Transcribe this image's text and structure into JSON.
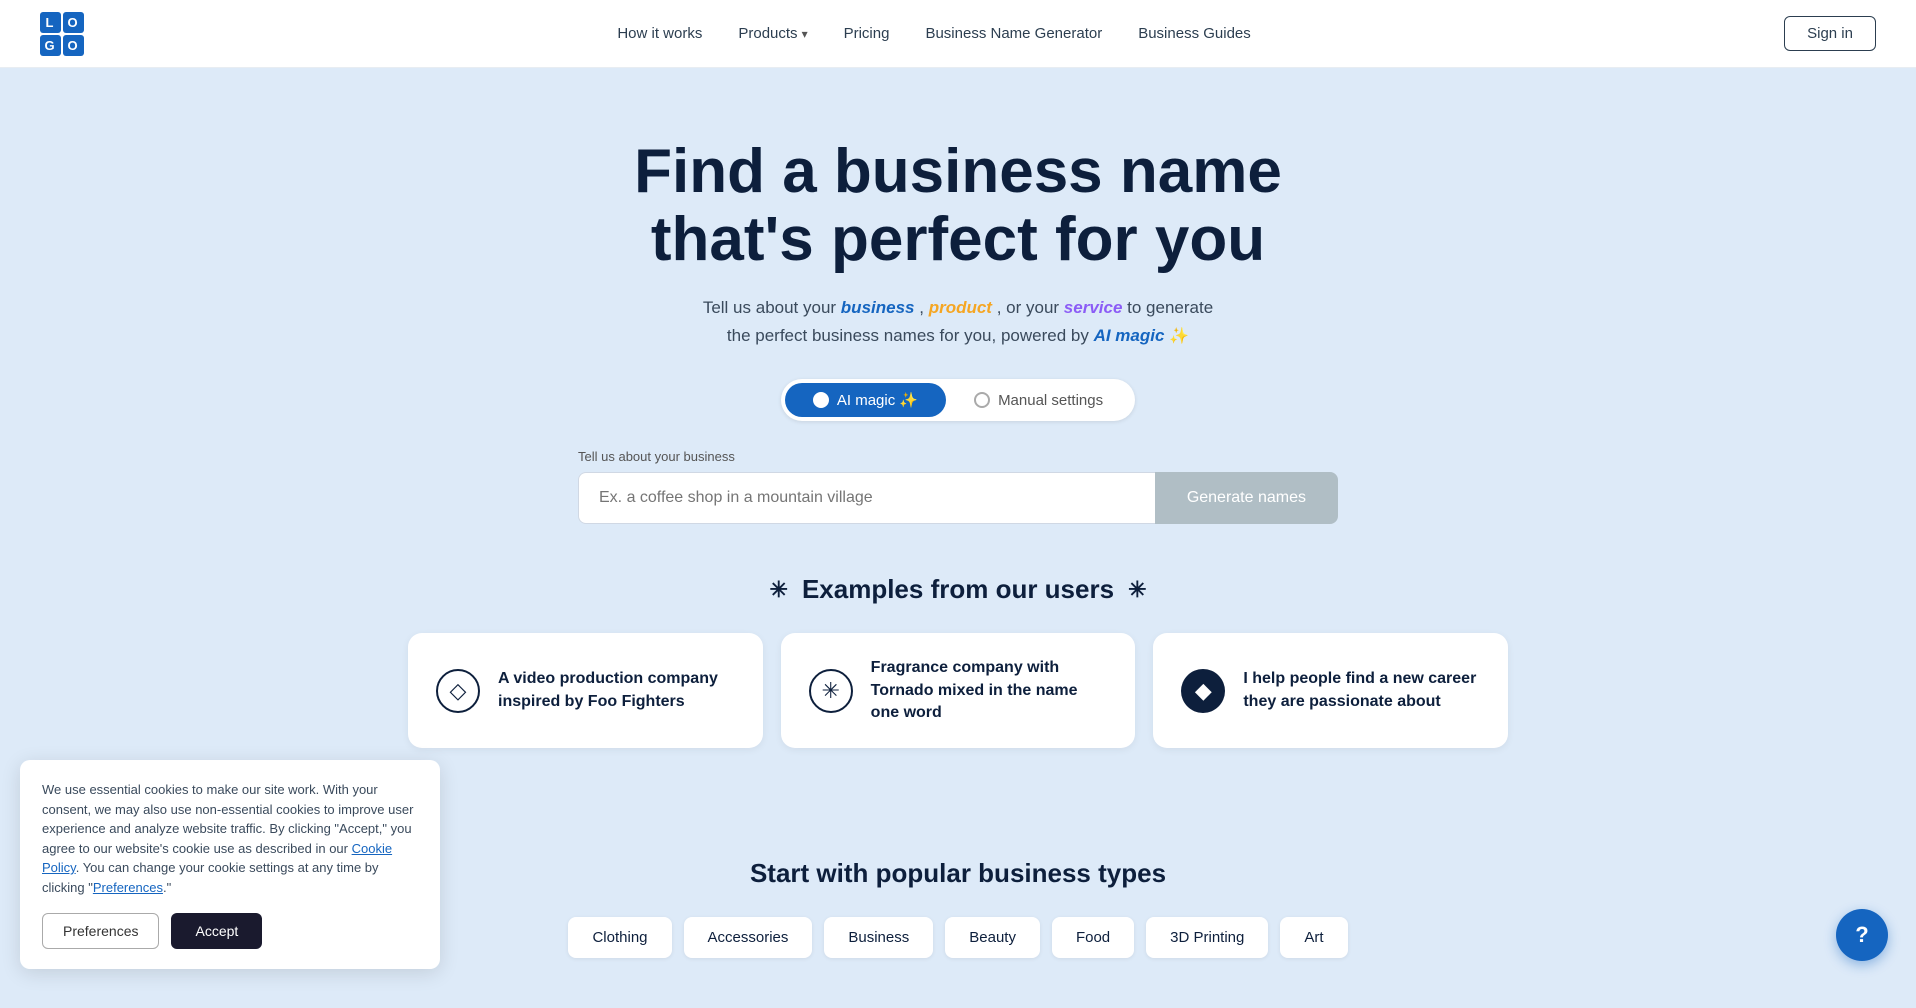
{
  "navbar": {
    "logo_text": "LO\nGO",
    "nav_items": [
      {
        "label": "How it works",
        "id": "how-it-works"
      },
      {
        "label": "Products",
        "id": "products",
        "hasDropdown": true
      },
      {
        "label": "Pricing",
        "id": "pricing"
      },
      {
        "label": "Business Name Generator",
        "id": "business-name-generator"
      },
      {
        "label": "Business Guides",
        "id": "business-guides"
      }
    ],
    "sign_in_label": "Sign in"
  },
  "hero": {
    "title": "Find a business name that's perfect for you",
    "subtitle_plain1": "Tell us about your ",
    "subtitle_highlight1": "business",
    "subtitle_plain2": ", ",
    "subtitle_highlight2": "product",
    "subtitle_plain3": ", or your ",
    "subtitle_highlight3": "service",
    "subtitle_plain4": " to generate",
    "subtitle_line2": "the perfect business names for you, powered by ",
    "subtitle_highlight4": "AI magic",
    "sparkle": "✨",
    "toggle_ai_label": "AI magic ✨",
    "toggle_manual_label": "Manual settings",
    "input_label": "Tell us about your business",
    "input_placeholder": "Ex. a coffee shop in a mountain village",
    "generate_btn_label": "Generate names"
  },
  "examples": {
    "title": "Examples from our users",
    "cards": [
      {
        "id": "card-1",
        "icon": "◇",
        "icon_type": "outline",
        "text": "A video production company inspired by Foo Fighters"
      },
      {
        "id": "card-2",
        "icon": "✳",
        "icon_type": "star",
        "text": "Fragrance company with Tornado mixed in the name one word"
      },
      {
        "id": "card-3",
        "icon": "◆",
        "icon_type": "dark",
        "text": "I help people find a new career they are passionate about"
      }
    ]
  },
  "business_types": {
    "title": "Start with popular business types",
    "pills": [
      "Clothing",
      "Accessories",
      "Business",
      "Beauty",
      "Food",
      "3D Printing",
      "Art"
    ]
  },
  "cookie_banner": {
    "text": "We use essential cookies to make our site work. With your consent, we may also use non-essential cookies to improve user experience and analyze website traffic. By clicking \"Accept,\" you agree to our website's cookie use as described in our Cookie Policy. You can change your cookie settings at any time by clicking \"Preferences.\"",
    "cookie_policy_label": "Cookie Policy",
    "preferences_label": "Preferences",
    "preferences_link_label": "Preferences",
    "accept_label": "Accept"
  },
  "help": {
    "label": "?"
  }
}
